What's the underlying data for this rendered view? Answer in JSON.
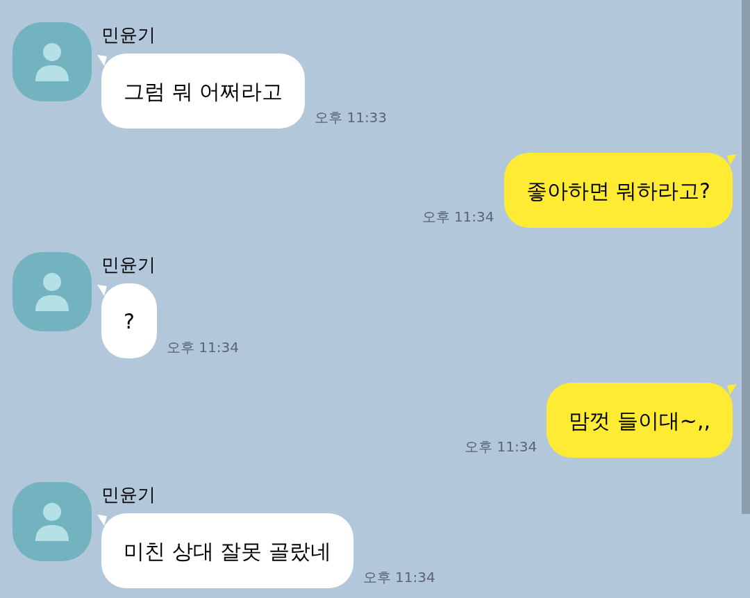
{
  "messages": [
    {
      "kind": "received",
      "sender": "민윤기",
      "text": "그럼 뭐 어쩌라고",
      "time": "오후 11:33"
    },
    {
      "kind": "sent",
      "text": "좋아하면 뭐하라고?",
      "time": "오후 11:34"
    },
    {
      "kind": "received",
      "sender": "민윤기",
      "text": "?",
      "time": "오후 11:34"
    },
    {
      "kind": "sent",
      "text": "맘껏 들이대~,,",
      "time": "오후 11:34"
    },
    {
      "kind": "received",
      "sender": "민윤기",
      "text": "미친 상대 잘못 골랐네",
      "time": "오후 11:34"
    }
  ]
}
